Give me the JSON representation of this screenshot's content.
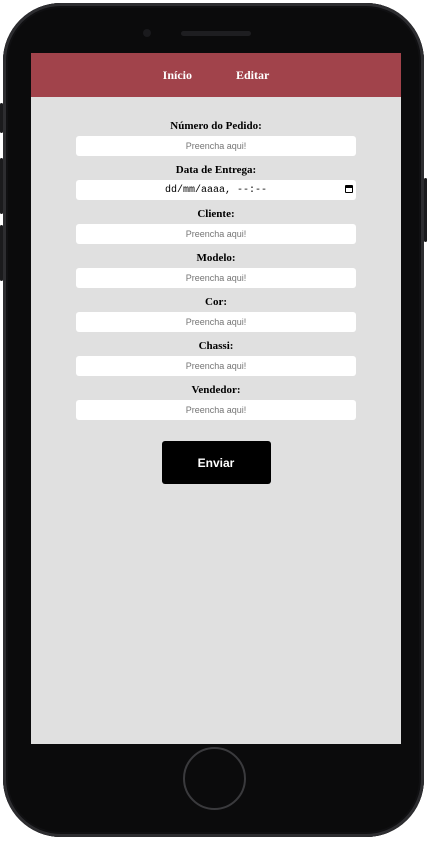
{
  "nav": {
    "items": [
      {
        "label": "Início"
      },
      {
        "label": "Editar"
      }
    ]
  },
  "form": {
    "fields": [
      {
        "label": "Número do Pedido:",
        "placeholder": "Preencha aqui!"
      },
      {
        "label": "Data de Entrega:",
        "value": "dd/mm/aaaa, --:--"
      },
      {
        "label": "Cliente:",
        "placeholder": "Preencha aqui!"
      },
      {
        "label": "Modelo:",
        "placeholder": "Preencha aqui!"
      },
      {
        "label": "Cor:",
        "placeholder": "Preencha aqui!"
      },
      {
        "label": "Chassi:",
        "placeholder": "Preencha aqui!"
      },
      {
        "label": "Vendedor:",
        "placeholder": "Preencha aqui!"
      }
    ],
    "submit_label": "Enviar"
  },
  "colors": {
    "navbar": "#a1434b",
    "screen_bg": "#e0e0e0",
    "button_bg": "#000000"
  },
  "icons": {
    "date": "calendar-icon"
  }
}
